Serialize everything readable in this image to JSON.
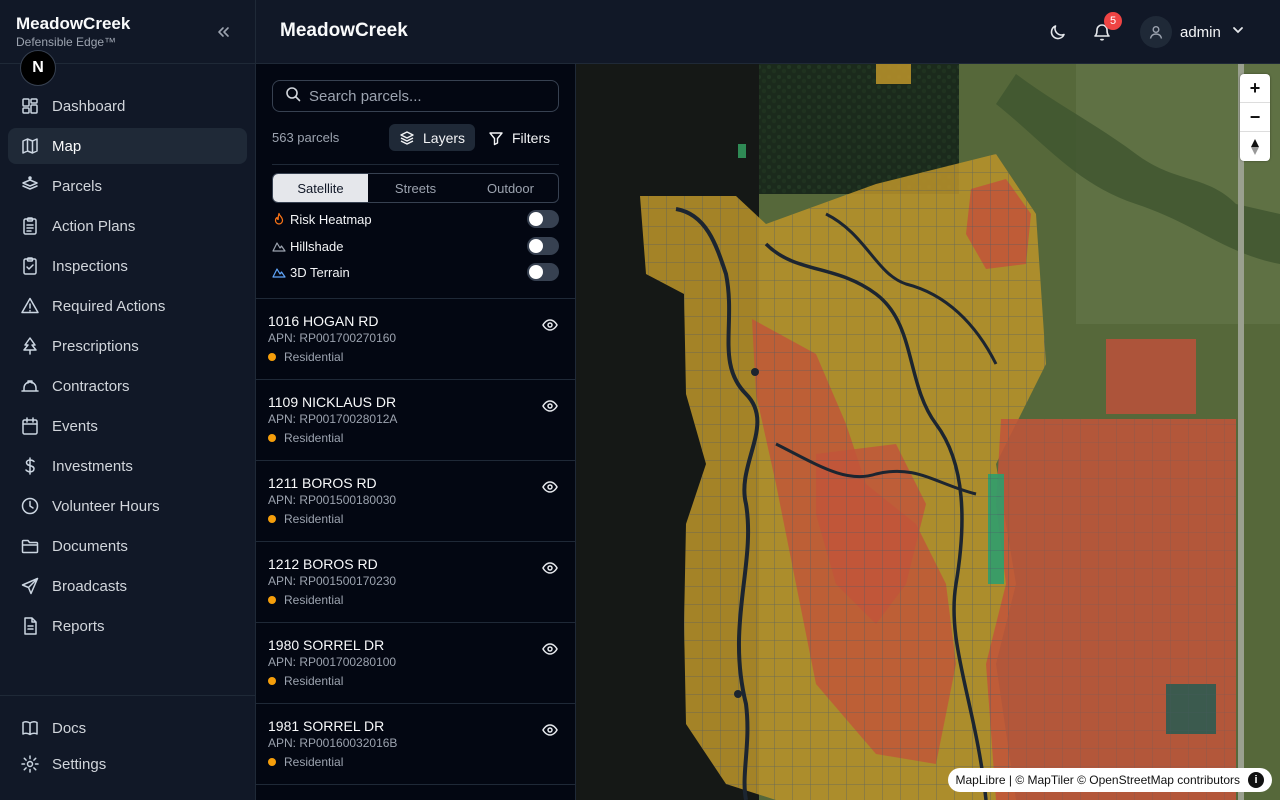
{
  "brand": {
    "title": "MeadowCreek",
    "subtitle": "Defensible Edge™"
  },
  "nav": [
    {
      "label": "Dashboard",
      "icon": "dashboard-icon"
    },
    {
      "label": "Map",
      "icon": "map-icon"
    },
    {
      "label": "Parcels",
      "icon": "parcels-icon"
    },
    {
      "label": "Action Plans",
      "icon": "clipboard-icon"
    },
    {
      "label": "Inspections",
      "icon": "clipboard-check-icon"
    },
    {
      "label": "Required Actions",
      "icon": "warning-icon"
    },
    {
      "label": "Prescriptions",
      "icon": "tree-icon"
    },
    {
      "label": "Contractors",
      "icon": "hard-hat-icon"
    },
    {
      "label": "Events",
      "icon": "calendar-icon"
    },
    {
      "label": "Investments",
      "icon": "dollar-icon"
    },
    {
      "label": "Volunteer Hours",
      "icon": "clock-icon"
    },
    {
      "label": "Documents",
      "icon": "folder-icon"
    },
    {
      "label": "Broadcasts",
      "icon": "send-icon"
    },
    {
      "label": "Reports",
      "icon": "file-icon"
    }
  ],
  "nav_active": "Map",
  "bottom_nav": [
    {
      "label": "Docs",
      "icon": "book-icon"
    },
    {
      "label": "Settings",
      "icon": "gear-icon"
    }
  ],
  "header": {
    "title": "MeadowCreek",
    "notifications": "5",
    "user": "admin"
  },
  "panel": {
    "search_placeholder": "Search parcels...",
    "count": "563 parcels",
    "layers_label": "Layers",
    "filters_label": "Filters",
    "basemaps": [
      "Satellite",
      "Streets",
      "Outdoor"
    ],
    "basemap_selected": "Satellite",
    "toggles": [
      {
        "label": "Risk Heatmap",
        "on": false,
        "icon": "flame-icon",
        "color": "#f97316"
      },
      {
        "label": "Hillshade",
        "on": false,
        "icon": "mountain-icon",
        "color": "#9ca3af"
      },
      {
        "label": "3D Terrain",
        "on": false,
        "icon": "mountain-icon",
        "color": "#60a5fa"
      }
    ]
  },
  "parcels": [
    {
      "address": "1016 HOGAN RD",
      "apn": "APN: RP001700270160",
      "type": "Residential"
    },
    {
      "address": "1109 NICKLAUS DR",
      "apn": "APN: RP00170028012A",
      "type": "Residential"
    },
    {
      "address": "1211 BOROS RD",
      "apn": "APN: RP001500180030",
      "type": "Residential"
    },
    {
      "address": "1212 BOROS RD",
      "apn": "APN: RP001500170230",
      "type": "Residential"
    },
    {
      "address": "1980 SORREL DR",
      "apn": "APN: RP001700280100",
      "type": "Residential"
    },
    {
      "address": "1981 SORREL DR",
      "apn": "APN: RP00160032016B",
      "type": "Residential"
    }
  ],
  "map": {
    "zoom_in": "+",
    "zoom_out": "−",
    "attribution": "MapLibre | © MapTiler © OpenStreetMap contributors",
    "colors": {
      "moderate": "#b8922a",
      "high": "#c2543a",
      "low": "#2f9d6d"
    }
  }
}
